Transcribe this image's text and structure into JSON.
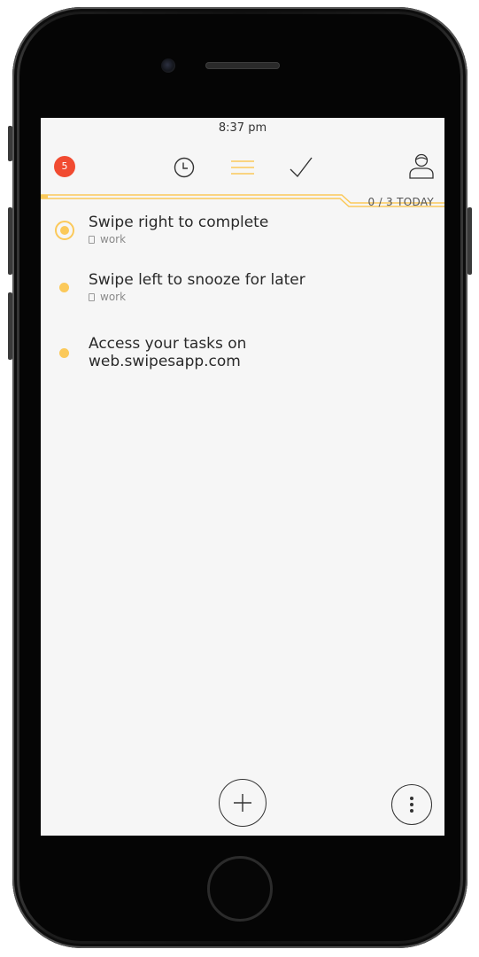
{
  "status_bar": {
    "time": "8:37 pm"
  },
  "header": {
    "badge_count": "5",
    "icons": [
      "clock-icon",
      "list-icon",
      "check-icon",
      "profile-icon"
    ],
    "accent_color": "#fbc95a",
    "badge_color": "#f14b31"
  },
  "progress": {
    "label": "0 / 3 TODAY",
    "completed": 0,
    "total": 3
  },
  "tasks": [
    {
      "title": "Swipe right to complete",
      "tag": "work",
      "selected": true
    },
    {
      "title": "Swipe left to snooze for later",
      "tag": "work",
      "selected": false
    },
    {
      "title": "Access your tasks on web.swipesapp.com",
      "tag": "",
      "selected": false
    }
  ],
  "footer": {
    "icons": [
      "plus-icon",
      "more-vertical-icon"
    ]
  }
}
